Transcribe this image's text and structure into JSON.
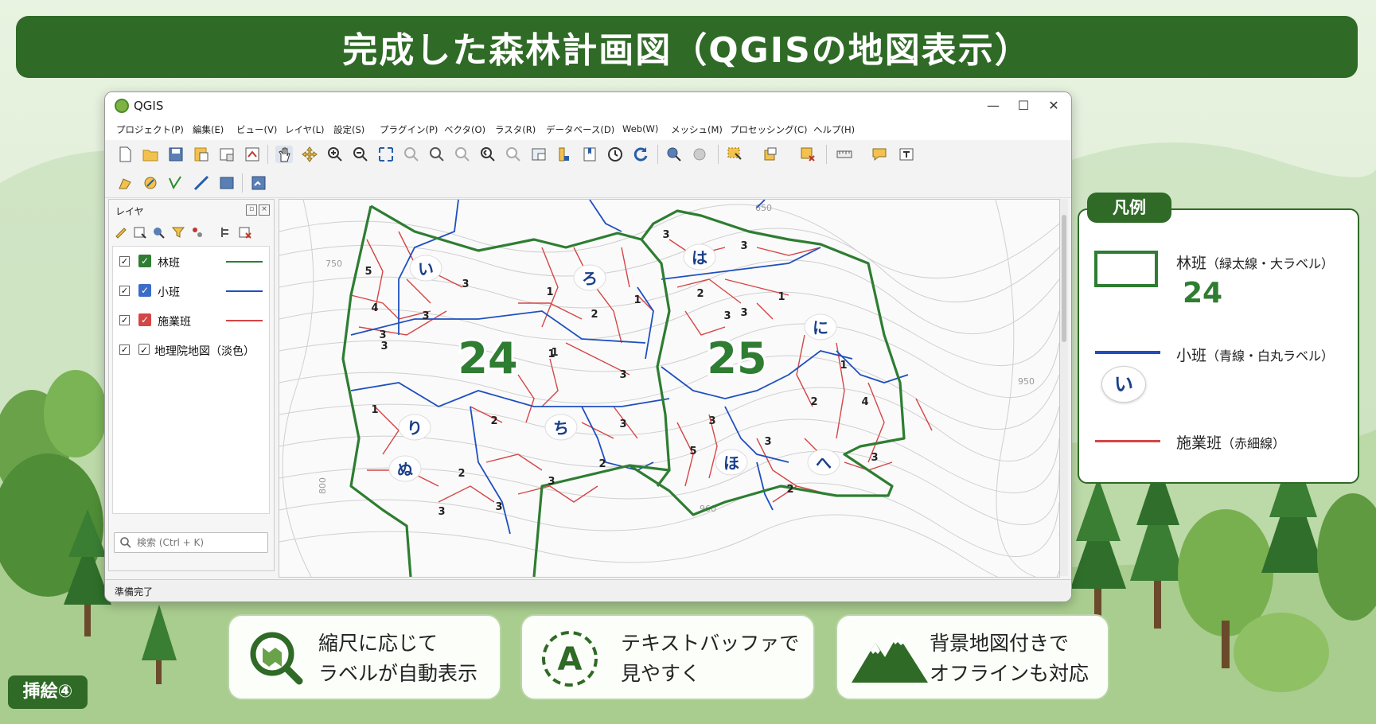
{
  "page_title": "完成した森林計画図（QGISの地図表示）",
  "window": {
    "title": "QGIS",
    "controls": {
      "minimize": "—",
      "maximize": "☐",
      "close": "✕"
    }
  },
  "menu": [
    "プロジェクト(P)",
    "編集(E)",
    "ビュー(V)",
    "レイヤ(L)",
    "設定(S)",
    "プラグイン(P)",
    "ベクタ(O)",
    "ラスタ(R)",
    "データベース(D)",
    "Web(W)",
    "メッシュ(M)",
    "プロセッシング(C)",
    "ヘルプ(H)"
  ],
  "toolbar_icons": [
    "new-project-icon",
    "open-project-icon",
    "save-project-icon",
    "save-as-icon",
    "print-layout-icon",
    "layout-manager-icon",
    "pan-icon",
    "pan-to-selection-icon",
    "zoom-in-icon",
    "zoom-out-icon",
    "zoom-full-icon",
    "zoom-to-selection-icon",
    "zoom-to-layer-icon",
    "zoom-native-icon",
    "zoom-last-icon",
    "zoom-next-icon",
    "new-map-view-icon",
    "temporal-icon",
    "bookmark-icon",
    "show-bookmarks-icon",
    "refresh-icon",
    "identify-icon",
    "action-icon",
    "select-icon",
    "deselect-icon",
    "attribute-table-icon",
    "measure-icon",
    "annotation-icon",
    "text-annotation-icon"
  ],
  "toolbar2_icons": [
    "digitize-icon",
    "edit-pencil-icon",
    "vertex-tool-icon",
    "digitize-line-icon",
    "save-edits-icon",
    "python-console-icon"
  ],
  "layers_panel": {
    "title": "レイヤ",
    "tools": [
      "open-style-icon",
      "add-group-icon",
      "manage-map-themes-icon",
      "filter-legend-icon",
      "filter-icon",
      "expand-all-icon",
      "remove-layer-icon"
    ],
    "layers": [
      {
        "name": "林班",
        "checked": true,
        "color": "#2e7d32",
        "line_color": "#2e7d32"
      },
      {
        "name": "小班",
        "checked": true,
        "color": "#3a6cc8",
        "line_color": "#1f4fbf"
      },
      {
        "name": "施業班",
        "checked": true,
        "color": "#d64545",
        "line_color": "#d64545"
      },
      {
        "name": "地理院地図（淡色）",
        "checked": true,
        "color": "#ffffff",
        "line_color": ""
      }
    ],
    "search_placeholder": "検索 (Ctrl + K)"
  },
  "status": "準備完了",
  "map": {
    "compartments": [
      "24",
      "25"
    ],
    "subcompartments": [
      "い",
      "ろ",
      "は",
      "に",
      "り",
      "ち",
      "ぬ",
      "ほ",
      "へ"
    ],
    "subsub_numbers": [
      "5",
      "3",
      "4",
      "3",
      "3",
      "1",
      "2",
      "1",
      "1",
      "3",
      "3",
      "2",
      "1",
      "3",
      "1",
      "2",
      "3",
      "2",
      "3",
      "2",
      "3",
      "3",
      "3",
      "2",
      "3",
      "5",
      "3",
      "3",
      "4",
      "1",
      "3",
      "2",
      "1",
      "3"
    ],
    "contours": [
      "750",
      "650",
      "950",
      "960",
      "800"
    ]
  },
  "legend": {
    "title": "凡例",
    "items": [
      {
        "label": "林班",
        "note": "（緑太線・大ラベル）",
        "sample": "24",
        "color": "#2e7d32"
      },
      {
        "label": "小班",
        "note": "（青線・白丸ラベル）",
        "sample": "い",
        "color": "#1f4fbf"
      },
      {
        "label": "施業班",
        "note": "（赤細線）",
        "color": "#d64545"
      }
    ]
  },
  "features": [
    {
      "icon": "map-magnifier-icon",
      "lines": [
        "縮尺に応じて",
        "ラベルが自動表示"
      ]
    },
    {
      "icon": "text-buffer-icon",
      "icon_letter": "A",
      "lines": [
        "テキストバッファで",
        "見やすく"
      ]
    },
    {
      "icon": "mountain-icon",
      "lines": [
        "背景地図付きで",
        "オフラインも対応"
      ]
    }
  ],
  "badge": "挿絵④"
}
